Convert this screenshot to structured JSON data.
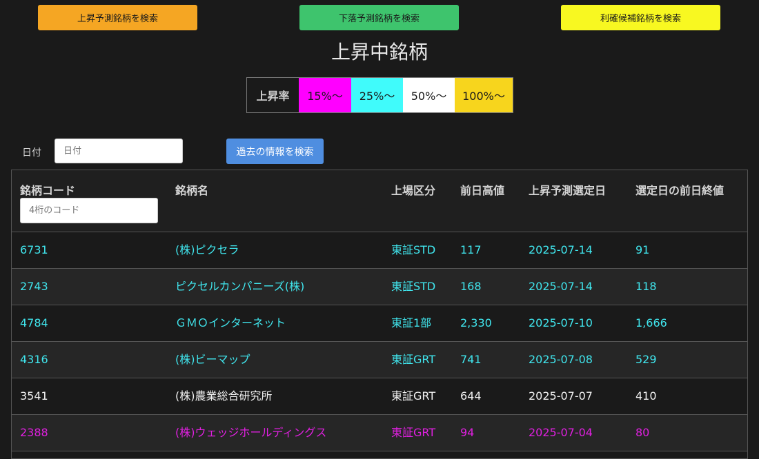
{
  "top_buttons": {
    "rise_search": "上昇予測銘柄を検索",
    "fall_search": "下落予測銘柄を検索",
    "profit_search": "利確候補銘柄を検索"
  },
  "title": "上昇中銘柄",
  "legend": {
    "label": "上昇率",
    "items": [
      "15%〜",
      "25%〜",
      "50%〜",
      "100%〜"
    ],
    "colors": [
      "#ff00ff",
      "#40fbfb",
      "#ffffff",
      "#f7d51d"
    ]
  },
  "filter": {
    "date_label": "日付",
    "date_placeholder": "日付",
    "search_past_label": "過去の情報を検索"
  },
  "table": {
    "headers": {
      "code": "銘柄コード",
      "name": "銘柄名",
      "market": "上場区分",
      "prev_high": "前日高値",
      "selected_date": "上昇予測選定日",
      "prev_close": "選定日の前日終値"
    },
    "code_placeholder": "4桁のコード",
    "rows": [
      {
        "code": "6731",
        "name": "(株)ピクセラ",
        "market": "東証STD",
        "prev_high": "117",
        "selected_date": "2025-07-14",
        "prev_close": "91",
        "color": "#40e6ee"
      },
      {
        "code": "2743",
        "name": "ピクセルカンパニーズ(株)",
        "market": "東証STD",
        "prev_high": "168",
        "selected_date": "2025-07-14",
        "prev_close": "118",
        "color": "#40e6ee"
      },
      {
        "code": "4784",
        "name": "ＧＭＯインターネット",
        "market": "東証1部",
        "prev_high": "2,330",
        "selected_date": "2025-07-10",
        "prev_close": "1,666",
        "color": "#40e6ee"
      },
      {
        "code": "4316",
        "name": "(株)ビーマップ",
        "market": "東証GRT",
        "prev_high": "741",
        "selected_date": "2025-07-08",
        "prev_close": "529",
        "color": "#40e6ee"
      },
      {
        "code": "3541",
        "name": "(株)農業総合研究所",
        "market": "東証GRT",
        "prev_high": "644",
        "selected_date": "2025-07-07",
        "prev_close": "410",
        "color": "#f2f2f2"
      },
      {
        "code": "2388",
        "name": "(株)ウェッジホールディングス",
        "market": "東証GRT",
        "prev_high": "94",
        "selected_date": "2025-07-04",
        "prev_close": "80",
        "color": "#e020e0"
      }
    ]
  }
}
